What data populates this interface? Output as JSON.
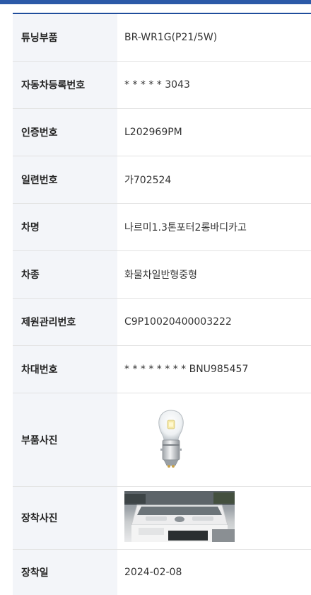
{
  "rows": [
    {
      "label": "튜닝부품",
      "value": "BR-WR1G(P21/5W)"
    },
    {
      "label": "자동차등록번호",
      "value": "* * * * * 3043"
    },
    {
      "label": "인증번호",
      "value": "L202969PM"
    },
    {
      "label": "일련번호",
      "value": "가702524"
    },
    {
      "label": "차명",
      "value": "나르미1.3톤포터2롱바디카고"
    },
    {
      "label": "차종",
      "value": "화물차일반형중형"
    },
    {
      "label": "제원관리번호",
      "value": "C9P10020400003222"
    },
    {
      "label": "차대번호",
      "value": "* * * * * * * * BNU985457"
    }
  ],
  "part_photo": {
    "label": "부품사진",
    "icon": "led-bulb-icon"
  },
  "install_photo": {
    "label": "장착사진",
    "icon": "truck-photo"
  },
  "install_date": {
    "label": "장착일",
    "value": "2024-02-08"
  },
  "colors": {
    "accent": "#1f4d9c",
    "header_bg": "#f3f5f9"
  }
}
